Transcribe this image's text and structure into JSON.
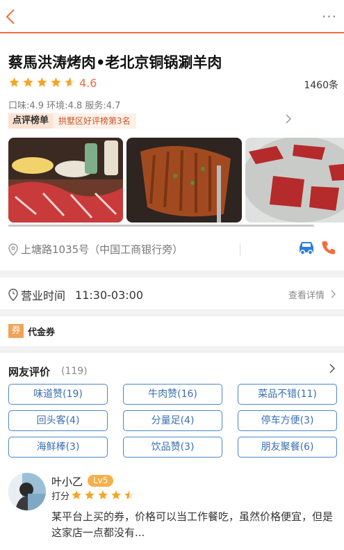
{
  "header": {
    "back_icon": "chevron-left-icon",
    "more_label": "···"
  },
  "shop": {
    "name": "蔡馬洪涛烤肉•老北京铜锅涮羊肉",
    "score": "4.6",
    "review_count": "1460条",
    "subscores": "口味:4.9 环境:4.8 服务:4.7",
    "rank_tag": "点评榜单",
    "rank_text": "拱墅区好评榜第3名",
    "star_rating": 4.6
  },
  "photos": [
    "bbq-platter",
    "roasted-lamb",
    "raw-meat-slices"
  ],
  "address": {
    "text": "上塘路1035号（中国工商银行旁）"
  },
  "hours": {
    "label": "营业时间",
    "time": "11:30-03:00",
    "detail_label": "查看详情"
  },
  "coupon": {
    "badge": "券",
    "label": "代金券"
  },
  "reviews": {
    "title": "网友评价",
    "count": "(119)",
    "tags": [
      "味道赞(19)",
      "牛肉赞(16)",
      "菜品不错(11)",
      "回头客(4)",
      "分量足(4)",
      "停车方便(3)",
      "海鲜棒(3)",
      "饮品赞(3)",
      "朋友聚餐(6)"
    ]
  },
  "review": {
    "user": "叶小乙",
    "level": "Lv5",
    "rate_label": "打分",
    "stars": 4.5,
    "text": "某平台上买的券，价格可以当工作餐吃，虽然价格便宜，但是这家店一点都没有..."
  },
  "colors": {
    "accent": "#f36c3a",
    "star": "#f5a623",
    "tag_blue": "#4a86c8"
  }
}
